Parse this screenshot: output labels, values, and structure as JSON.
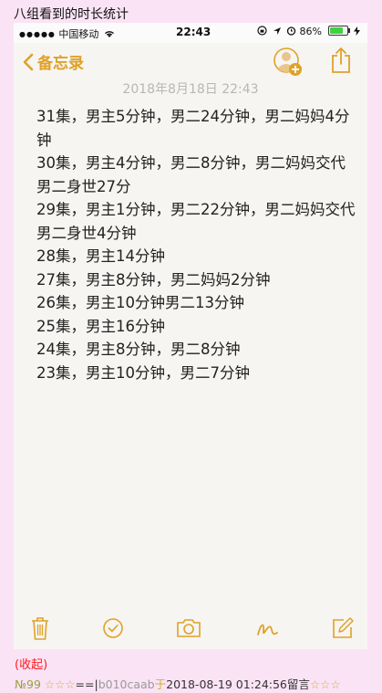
{
  "page": {
    "post_title": "八组看到的时长统计"
  },
  "statusbar": {
    "signal_dots": "●●●●●",
    "carrier": "中国移动",
    "time": "22:43",
    "battery_text": "86%",
    "battery_level": 0.86
  },
  "navbar": {
    "back_label": "备忘录"
  },
  "note": {
    "date": "2018年8月18日 22:43",
    "lines": [
      "31集，男主5分钟，男二24分钟，男二妈妈4分钟",
      "30集，男主4分钟，男二8分钟，男二妈妈交代男二身世27分",
      "29集，男主1分钟，男二22分钟，男二妈妈交代男二身世4分钟",
      "28集，男主14分钟",
      "27集，男主8分钟，男二妈妈2分钟",
      "26集，男主10分钟男二13分钟",
      "25集，男主16分钟",
      "24集，男主8分钟，男二8分钟",
      "23集，男主10分钟，男二7分钟"
    ]
  },
  "colors": {
    "accent": "#e0a128",
    "page_bg": "#fbe3f6",
    "note_bg": "#f6f5f2"
  },
  "footer": {
    "collapse_label": "(收起)",
    "number": "№99",
    "stars_left": "☆☆☆",
    "separator": "==|",
    "username": "b010caab",
    "at": "于",
    "datetime": "2018-08-19 01:24:56",
    "action": "留言",
    "stars_right": "☆☆☆"
  }
}
